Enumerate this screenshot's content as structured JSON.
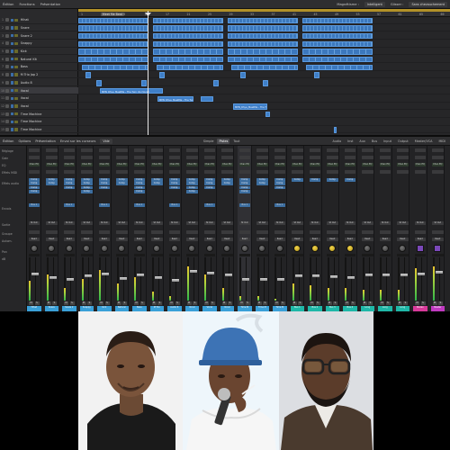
{
  "arrange": {
    "toolbar": {
      "edit": "Édition",
      "functions": "Fonctions",
      "display": "Présentation",
      "snap_label": "Magnétisme :",
      "snap_value": "Intelligent",
      "drag_label": "Glisser :",
      "drag_value": "Sans chevauchement"
    },
    "locator_label": "Meet Me Beat",
    "ruler": [
      "1",
      "5",
      "9",
      "13",
      "17",
      "21",
      "25",
      "29",
      "33",
      "37",
      "41",
      "45",
      "49",
      "53",
      "57",
      "61",
      "65",
      "69"
    ],
    "tracks": [
      {
        "num": "1",
        "name": "Hihat"
      },
      {
        "num": "2",
        "name": "Snare"
      },
      {
        "num": "3",
        "name": "Snare 2"
      },
      {
        "num": "4",
        "name": "Snappy"
      },
      {
        "num": "5",
        "name": "Kick"
      },
      {
        "num": "6",
        "name": "Natural Kit"
      },
      {
        "num": "7",
        "name": "Bass"
      },
      {
        "num": "8",
        "name": "M Trio Jap 2"
      },
      {
        "num": "9",
        "name": "Audio 8"
      },
      {
        "num": "10",
        "name": "Vocal"
      },
      {
        "num": "11",
        "name": "Vocal"
      },
      {
        "num": "12",
        "name": "Vocal"
      },
      {
        "num": "13",
        "name": "Time Machine"
      },
      {
        "num": "14",
        "name": "Time Machine"
      },
      {
        "num": "15",
        "name": "Time Machine"
      }
    ],
    "regions": {
      "vocal_1": "MEN_Rhye_MeetMe - The Turn Up (Vocal)",
      "vocal_2": "MEN_Rhye_MeetMe - The Turn Up (Vocal)",
      "vocal_3": "MEN_Rhye_MeetMe - The Turn Up (Vocal)"
    }
  },
  "mixer": {
    "toolbar": {
      "edit": "Édition",
      "options": "Options",
      "display": "Présentation",
      "send_label": "Envoi sur les curseurs",
      "send_value": "Vide",
      "filters": [
        "Simple",
        "Pistes",
        "Tout"
      ],
      "active_filter": "Pistes",
      "types": [
        "Audio",
        "Inst",
        "Aux",
        "Bus",
        "Input",
        "Output",
        "Master/VCA",
        "MIDI"
      ]
    },
    "row_labels": [
      "Réglage",
      "Gain",
      "EQ",
      "Effets MIDI",
      "Effets audio",
      "Envois",
      "Sortie",
      "Groupe",
      "Autom.",
      "Pan",
      "dB"
    ],
    "strips": [
      {
        "name": "Hihat",
        "color": "#3aa0d8"
      },
      {
        "name": "Snare",
        "color": "#3aa0d8"
      },
      {
        "name": "Snare 2",
        "color": "#3aa0d8"
      },
      {
        "name": "Snappy",
        "color": "#3aa0d8"
      },
      {
        "name": "Kick",
        "color": "#3aa0d8"
      },
      {
        "name": "Natural",
        "color": "#3aa0d8"
      },
      {
        "name": "Bass",
        "color": "#3aa0d8"
      },
      {
        "name": "M Trio",
        "color": "#3aa0d8"
      },
      {
        "name": "Audio 8",
        "color": "#3aa0d8"
      },
      {
        "name": "Vocal",
        "color": "#3aa0d8"
      },
      {
        "name": "Vocal",
        "color": "#3aa0d8"
      },
      {
        "name": "Vocal",
        "color": "#3aa0d8"
      },
      {
        "name": "Time M",
        "color": "#3aa0d8"
      },
      {
        "name": "Time M",
        "color": "#3aa0d8"
      },
      {
        "name": "Time M",
        "color": "#3aa0d8"
      },
      {
        "name": "Bus 1",
        "color": "#1fb8a8"
      },
      {
        "name": "Bus 2",
        "color": "#1fb8a8"
      },
      {
        "name": "Bus 3",
        "color": "#1fb8a8"
      },
      {
        "name": "Bus 4",
        "color": "#1fb8a8"
      },
      {
        "name": "Long",
        "color": "#1fb8a8"
      },
      {
        "name": "Long",
        "color": "#1fb8a8"
      },
      {
        "name": "Long",
        "color": "#1fb8a8"
      },
      {
        "name": "Stereo",
        "color": "#d83a9a"
      },
      {
        "name": "Master",
        "color": "#c03ac0"
      }
    ],
    "plugin_label": "Comp",
    "eq_label": "Chan EQ",
    "send_label": "Bus 1",
    "output_label": "St Out",
    "read_label": "Read",
    "mute": "M",
    "solo": "S"
  },
  "collage": {
    "person_1": "person-1",
    "person_2": "person-2",
    "person_3": "person-3"
  }
}
